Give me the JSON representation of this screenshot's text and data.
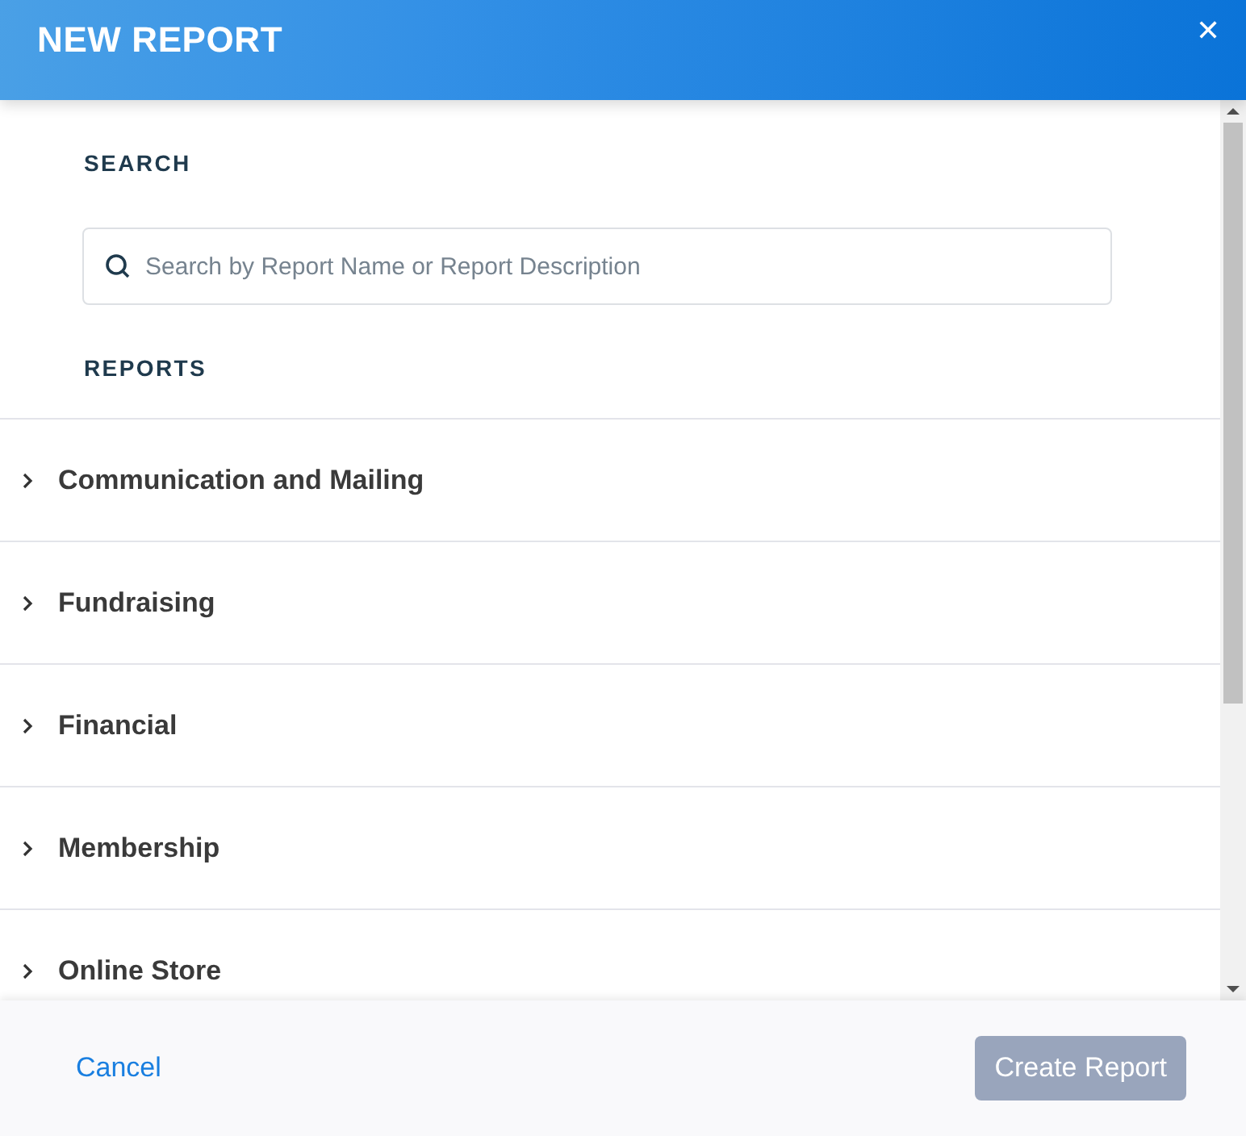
{
  "window": {
    "title": "NEW REPORT",
    "close": "✕"
  },
  "search": {
    "label": "SEARCH",
    "placeholder": "Search by Report Name or Report Description"
  },
  "reports": {
    "label": "REPORTS",
    "categories": [
      {
        "name": "Communication and Mailing",
        "expanded": false
      },
      {
        "name": "Fundraising",
        "expanded": false
      },
      {
        "name": "Financial",
        "expanded": false
      },
      {
        "name": "Membership",
        "expanded": false
      },
      {
        "name": "Online Store",
        "expanded": false
      }
    ]
  },
  "footer": {
    "cancel": "Cancel",
    "create": {
      "label": "Create Report",
      "disabled": true
    }
  }
}
